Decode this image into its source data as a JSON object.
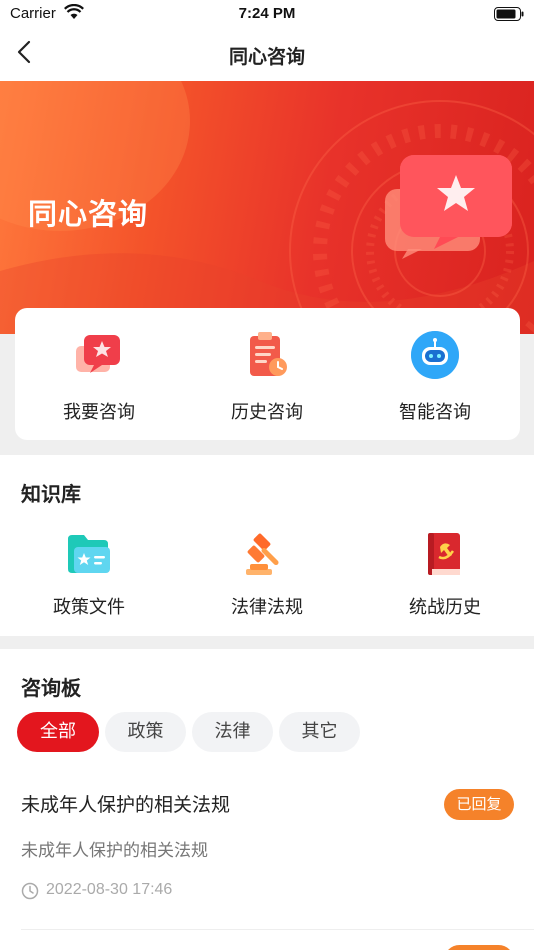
{
  "status_bar": {
    "carrier": "Carrier",
    "time": "7:24 PM"
  },
  "nav": {
    "title": "同心咨询"
  },
  "banner": {
    "title": "同心咨询"
  },
  "quick_actions": [
    {
      "label": "我要咨询",
      "icon": "consult-chat-icon"
    },
    {
      "label": "历史咨询",
      "icon": "history-clipboard-icon"
    },
    {
      "label": "智能咨询",
      "icon": "robot-icon"
    }
  ],
  "knowledge_base": {
    "title": "知识库",
    "items": [
      {
        "label": "政策文件",
        "icon": "policy-folder-icon"
      },
      {
        "label": "法律法规",
        "icon": "gavel-icon"
      },
      {
        "label": "统战历史",
        "icon": "history-book-icon"
      }
    ]
  },
  "board": {
    "title": "咨询板",
    "filters": [
      "全部",
      "政策",
      "法律",
      "其它"
    ],
    "active_filter": "全部",
    "posts": [
      {
        "title": "未成年人保护的相关法规",
        "status": "已回复",
        "description": "未成年人保护的相关法规",
        "time": "2022-08-30 17:46"
      }
    ]
  },
  "colors": {
    "brand_red": "#e3161e",
    "badge_orange": "#f5822a"
  }
}
